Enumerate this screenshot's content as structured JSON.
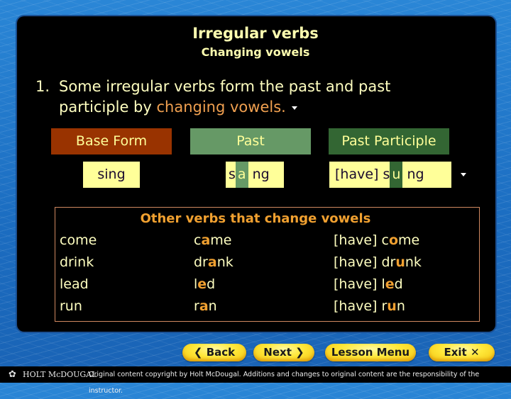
{
  "header": {
    "title": "Irregular verbs",
    "subtitle": "Changing vowels"
  },
  "bullet": {
    "number": "1.",
    "line1": "Some irregular verbs form the past and past",
    "line2_prefix": "participle by ",
    "line2_highlight": "changing vowels.",
    "arrow_icon": "triangle-down"
  },
  "table": {
    "headers": {
      "base": "Base Form",
      "past": "Past",
      "past_participle": "Past Participle"
    },
    "example": {
      "base": "sing",
      "past": {
        "pre": "s",
        "vowel": "a",
        "post": "ng"
      },
      "past_participle": {
        "pre": "[have] s",
        "vowel": "u",
        "post": "ng"
      }
    },
    "colors": {
      "base_header": "#993300",
      "past_header": "#669966",
      "pp_header": "#336633",
      "word_bg": "#ffff99"
    }
  },
  "other_verbs": {
    "title": "Other verbs that change vowels",
    "rows": [
      {
        "base": "come",
        "past": {
          "pre": "c",
          "vowel": "a",
          "post": "me"
        },
        "pp": {
          "pre": "[have] c",
          "vowel": "o",
          "post": "me"
        }
      },
      {
        "base": "drink",
        "past": {
          "pre": "dr",
          "vowel": "a",
          "post": "nk"
        },
        "pp": {
          "pre": "[have] dr",
          "vowel": "u",
          "post": "nk"
        }
      },
      {
        "base": "lead",
        "past": {
          "pre": "l",
          "vowel": "e",
          "post": "d"
        },
        "pp": {
          "pre": "[have] l",
          "vowel": "e",
          "post": "d"
        }
      },
      {
        "base": "run",
        "past": {
          "pre": "r",
          "vowel": "a",
          "post": "n"
        },
        "pp": {
          "pre": "[have] r",
          "vowel": "u",
          "post": "n"
        }
      }
    ],
    "highlight_color": "#f0a030"
  },
  "nav": {
    "back": {
      "label": "Back",
      "icon": "chevron-left"
    },
    "next": {
      "label": "Next",
      "icon": "chevron-right"
    },
    "menu": {
      "label": "Lesson Menu"
    },
    "exit": {
      "label": "Exit",
      "icon": "close-x"
    }
  },
  "footer": {
    "brand": "HOLT McDOUGAL",
    "copyright": "Original content copyright by Holt McDougal.  Additions and changes to original content are the responsibility of the instructor."
  }
}
